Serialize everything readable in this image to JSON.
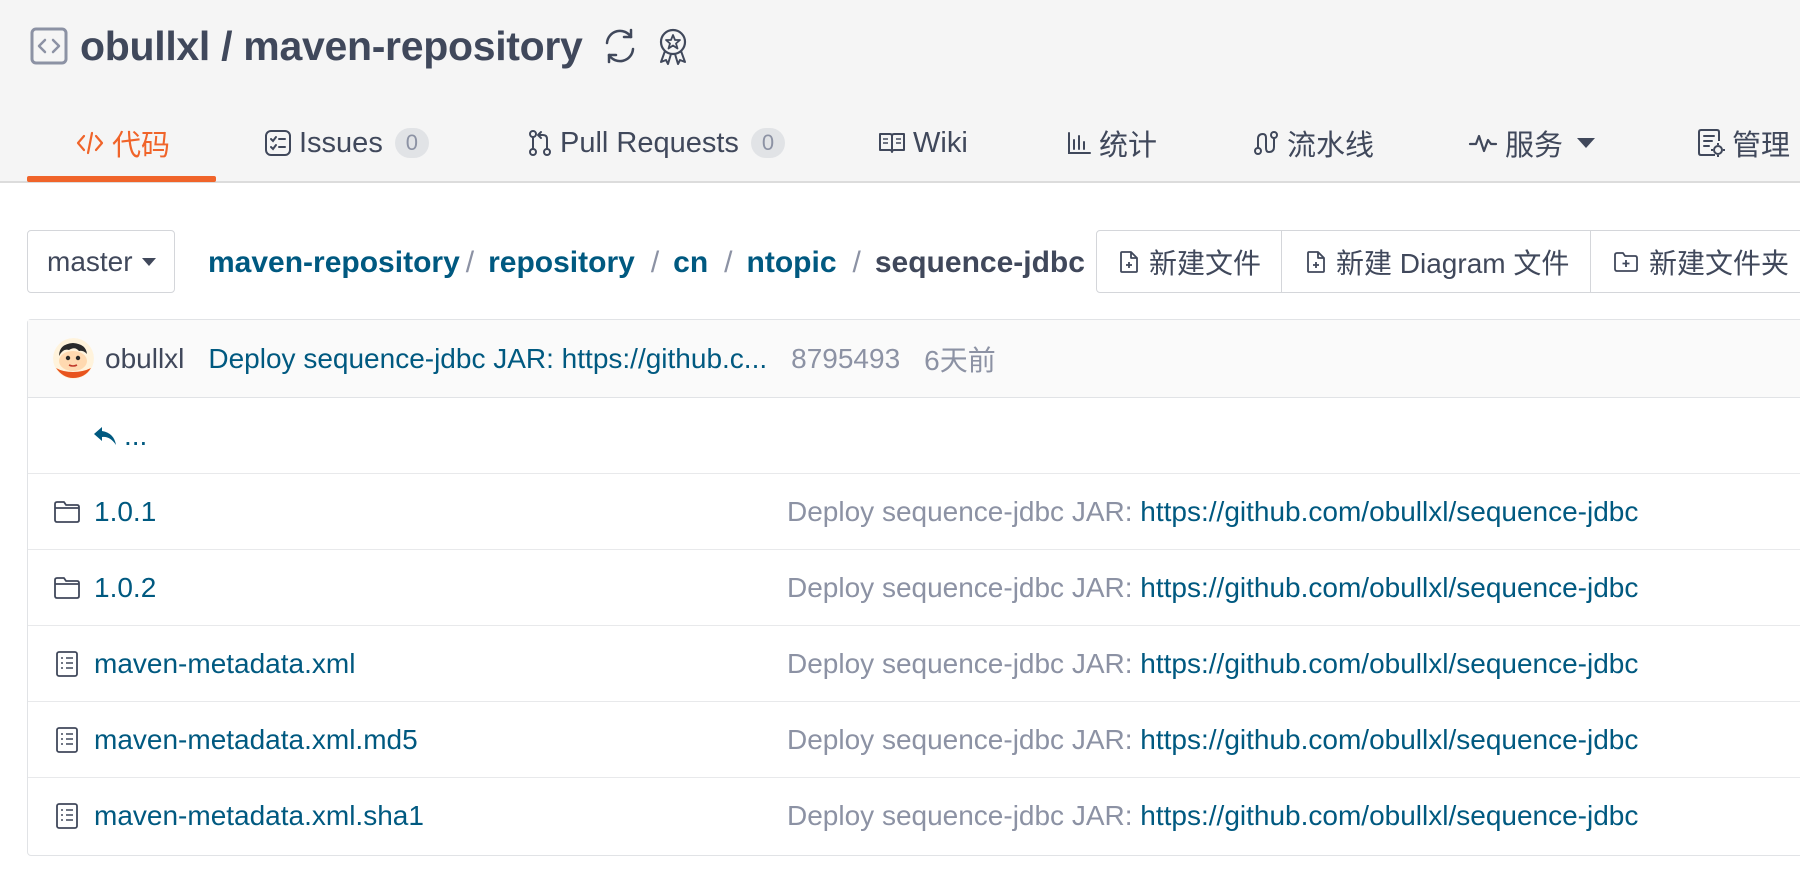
{
  "repo": {
    "owner": "obullxl",
    "separator": " / ",
    "name": "maven-repository"
  },
  "tabs": [
    {
      "label": "代码",
      "icon": "code-icon",
      "active": true
    },
    {
      "label": "Issues",
      "icon": "issues-icon",
      "count": "0"
    },
    {
      "label": "Pull Requests",
      "icon": "pull-request-icon",
      "count": "0"
    },
    {
      "label": "Wiki",
      "icon": "book-icon"
    },
    {
      "label": "统计",
      "icon": "bar-chart-icon"
    },
    {
      "label": "流水线",
      "icon": "pipeline-icon"
    },
    {
      "label": "服务",
      "icon": "activity-icon",
      "dropdown": true
    },
    {
      "label": "管理",
      "icon": "settings-doc-icon"
    }
  ],
  "branch": {
    "name": "master"
  },
  "breadcrumb": {
    "root": "maven-repository",
    "parts": [
      "repository",
      "cn",
      "ntopic"
    ],
    "current": "sequence-jdbc",
    "separator": "/"
  },
  "actions": {
    "new_file": "新建文件",
    "new_diagram": "新建 Diagram 文件",
    "new_folder": "新建文件夹"
  },
  "commit": {
    "author": "obullxl",
    "message": "Deploy sequence-jdbc JAR: https://github.c...",
    "sha": "8795493",
    "time": "6天前"
  },
  "parent_link": "...",
  "files": [
    {
      "name": "1.0.1",
      "type": "folder",
      "msg_prefix": "Deploy sequence-jdbc JAR: ",
      "msg_link": "https://github.com/obullxl/sequence-jdbc"
    },
    {
      "name": "1.0.2",
      "type": "folder",
      "msg_prefix": "Deploy sequence-jdbc JAR: ",
      "msg_link": "https://github.com/obullxl/sequence-jdbc"
    },
    {
      "name": "maven-metadata.xml",
      "type": "file",
      "msg_prefix": "Deploy sequence-jdbc JAR: ",
      "msg_link": "https://github.com/obullxl/sequence-jdbc"
    },
    {
      "name": "maven-metadata.xml.md5",
      "type": "file",
      "msg_prefix": "Deploy sequence-jdbc JAR: ",
      "msg_link": "https://github.com/obullxl/sequence-jdbc"
    },
    {
      "name": "maven-metadata.xml.sha1",
      "type": "file",
      "msg_prefix": "Deploy sequence-jdbc JAR: ",
      "msg_link": "https://github.com/obullxl/sequence-jdbc"
    }
  ],
  "colors": {
    "accent": "#f0642a",
    "link": "#005980",
    "text": "#40485b",
    "muted": "#8c92a4"
  }
}
